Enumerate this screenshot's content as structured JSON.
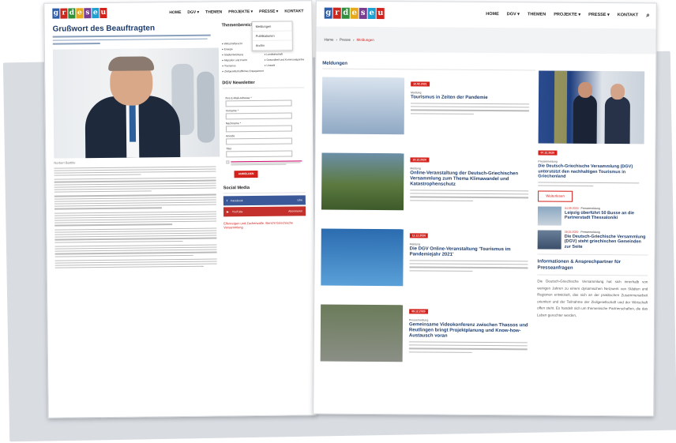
{
  "left": {
    "logo_letters": [
      "g",
      "r",
      "d",
      "e",
      "s",
      "e",
      "u"
    ],
    "nav": [
      "HOME",
      "DGV ▾",
      "THEMEN",
      "PROJEKTE ▾",
      "PRESSE ▾",
      "KONTAKT"
    ],
    "title": "Grußwort des Beauftragten",
    "photo_caption": "Norbert Barthle",
    "themes_heading": "Themenbereiche",
    "dropdown": [
      "Meldungen",
      "Publikationen",
      "Archiv"
    ],
    "themes": [
      "Wirtschaftsrecht",
      "Digitalisierung",
      "Energie",
      "Jugend und Sport",
      "Stadtentwicklung",
      "Landwirtschaft",
      "Migration und Flucht",
      "Gesundheit und Kommunalpartnerschaften",
      "Tourismus",
      "Umwelt",
      "Zivilgesellschaftliches Engagement"
    ],
    "newsletter_heading": "DGV Newsletter",
    "nl_fields": [
      "Ihre E-Mail-Adresse *",
      "Vorname *",
      "Nachname *",
      "Anrede",
      "Titel"
    ],
    "nl_button": "ANMELDEN",
    "social_heading": "Social Media",
    "social": [
      {
        "name": "Facebook",
        "action": "Like"
      },
      {
        "name": "YouTube",
        "action": "Abonnieren"
      }
    ],
    "foot_link": "Elfenreigen und Zuckerwatte. Bericht Griechische Versammlung"
  },
  "right": {
    "logo_letters": [
      "g",
      "r",
      "d",
      "e",
      "s",
      "e",
      "u"
    ],
    "nav": [
      "HOME",
      "DGV ▾",
      "THEMEN",
      "PROJEKTE ▾",
      "PRESSE ▾",
      "KONTAKT"
    ],
    "breadcrumb": [
      "Home",
      "Presse",
      "Meldungen"
    ],
    "section": "Meldungen",
    "posts": [
      {
        "date": "12.02.2021",
        "category": "Meldung",
        "title": "Tourismus in Zeiten der Pandemie"
      },
      {
        "date": "18.12.2020",
        "category": "Meldung",
        "title": "Online-Veranstaltung der Deutsch-Griechischen Versammlung zum Thema Klimawandel und Katastrophenschutz"
      },
      {
        "date": "11.12.2020",
        "category": "Meldung",
        "title": "Die DGV Online-Veranstaltung 'Tourismus im Pandemiejahr 2021'"
      },
      {
        "date": "09.12.2020",
        "category": "Pressemeldung",
        "title": "Gemeinsame Videokonferenz zwischen Thassos und Reutlingen bringt Projektplanung und Know-how-Austausch voran"
      }
    ],
    "featured": {
      "date": "07.12.2020",
      "category": "Pressemeldung",
      "title": "Die Deutsch-Griechische Versammlung (DGV) unterstützt den nachhaltigen Tourismus in Griechenland",
      "button": "Weiterlesen"
    },
    "mini": [
      {
        "date": "04.09.2020",
        "category": "Pressemeldung",
        "title": "Leipzig überführt 50 Busse an die Partnerstadt Thessaloniki"
      },
      {
        "date": "28.04.2020",
        "category": "Pressemeldung",
        "title": "Die Deutsch-Griechische Versammlung (DGV) steht griechischen Gemeinden zur Seite"
      }
    ],
    "info_heading": "Informationen & Ansprechpartner für Presseanfragen",
    "info_text": "Die Deutsch-Griechische Versammlung hat sich innerhalb von wenigen Jahren zu einem dynamischen Netzwerk von Städten und Regionen entwickelt, das sich an der praktischen Zusammenarbeit orientiert und der Teilnahme der Zivilgesellschaft und der Wirtschaft offen steht. Es handelt sich um themenische Partnerschaften, die das Leben gerechter werden,"
  },
  "colors": {
    "logo": [
      "#2b5da8",
      "#c8281e",
      "#2f8f3a",
      "#e6a91b",
      "#7a3c8f",
      "#1f9fd0",
      "#d3211b"
    ],
    "accent": "#d3211b",
    "heading": "#1d3d6e"
  }
}
